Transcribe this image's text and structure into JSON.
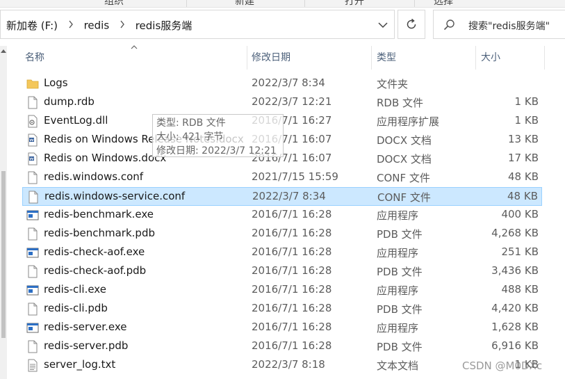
{
  "ribbon": {
    "labels": [
      "组织",
      "新建",
      "打开",
      "选择"
    ]
  },
  "address": {
    "breadcrumb": [
      "新加卷 (F:)",
      "redis",
      "redis服务端"
    ]
  },
  "search": {
    "placeholder": "搜索\"redis服务端\""
  },
  "columns": {
    "name": "名称",
    "date": "修改日期",
    "type": "类型",
    "size": "大小"
  },
  "files": [
    {
      "name": "Logs",
      "date": "2022/3/7 8:34",
      "type": "文件夹",
      "size": "",
      "icon": "folder-icon"
    },
    {
      "name": "dump.rdb",
      "date": "2022/3/7 12:21",
      "type": "RDB 文件",
      "size": "1 KB",
      "icon": "file-icon"
    },
    {
      "name": "EventLog.dll",
      "date": "2016/7/1 16:27",
      "type": "应用程序扩展",
      "size": "1 KB",
      "icon": "dll-icon"
    },
    {
      "name": "Redis on Windows Release Notes.docx",
      "date": "2016/7/1 16:07",
      "type": "DOCX 文档",
      "size": "13 KB",
      "icon": "docx-icon"
    },
    {
      "name": "Redis on Windows.docx",
      "date": "2016/7/1 16:07",
      "type": "DOCX 文档",
      "size": "17 KB",
      "icon": "docx-icon"
    },
    {
      "name": "redis.windows.conf",
      "date": "2021/7/15 15:59",
      "type": "CONF 文件",
      "size": "48 KB",
      "icon": "file-icon"
    },
    {
      "name": "redis.windows-service.conf",
      "date": "2022/3/7 8:34",
      "type": "CONF 文件",
      "size": "48 KB",
      "icon": "file-icon",
      "selected": true
    },
    {
      "name": "redis-benchmark.exe",
      "date": "2016/7/1 16:28",
      "type": "应用程序",
      "size": "400 KB",
      "icon": "exe-icon"
    },
    {
      "name": "redis-benchmark.pdb",
      "date": "2016/7/1 16:28",
      "type": "PDB 文件",
      "size": "4,268 KB",
      "icon": "file-icon"
    },
    {
      "name": "redis-check-aof.exe",
      "date": "2016/7/1 16:28",
      "type": "应用程序",
      "size": "251 KB",
      "icon": "exe-icon"
    },
    {
      "name": "redis-check-aof.pdb",
      "date": "2016/7/1 16:28",
      "type": "PDB 文件",
      "size": "3,436 KB",
      "icon": "file-icon"
    },
    {
      "name": "redis-cli.exe",
      "date": "2016/7/1 16:28",
      "type": "应用程序",
      "size": "488 KB",
      "icon": "exe-icon"
    },
    {
      "name": "redis-cli.pdb",
      "date": "2016/7/1 16:28",
      "type": "PDB 文件",
      "size": "4,420 KB",
      "icon": "file-icon"
    },
    {
      "name": "redis-server.exe",
      "date": "2016/7/1 16:28",
      "type": "应用程序",
      "size": "1,628 KB",
      "icon": "exe-icon"
    },
    {
      "name": "redis-server.pdb",
      "date": "2016/7/1 16:28",
      "type": "PDB 文件",
      "size": "6,916 KB",
      "icon": "file-icon"
    },
    {
      "name": "server_log.txt",
      "date": "2022/3/7 8:18",
      "type": "文本文档",
      "size": "1 KB",
      "icon": "txt-icon"
    }
  ],
  "tooltip": {
    "line1": "类型: RDB 文件",
    "line2": "大小: 421 字节",
    "line3": "修改日期: 2022/3/7 12:21"
  },
  "watermark": "CSDN @M0DXc",
  "colors": {
    "selection_bg": "#cce8ff",
    "selection_border": "#99d1ff",
    "header_text": "#4c607a",
    "folder": "#f4c75b",
    "exe_blue": "#2d6fc4"
  }
}
